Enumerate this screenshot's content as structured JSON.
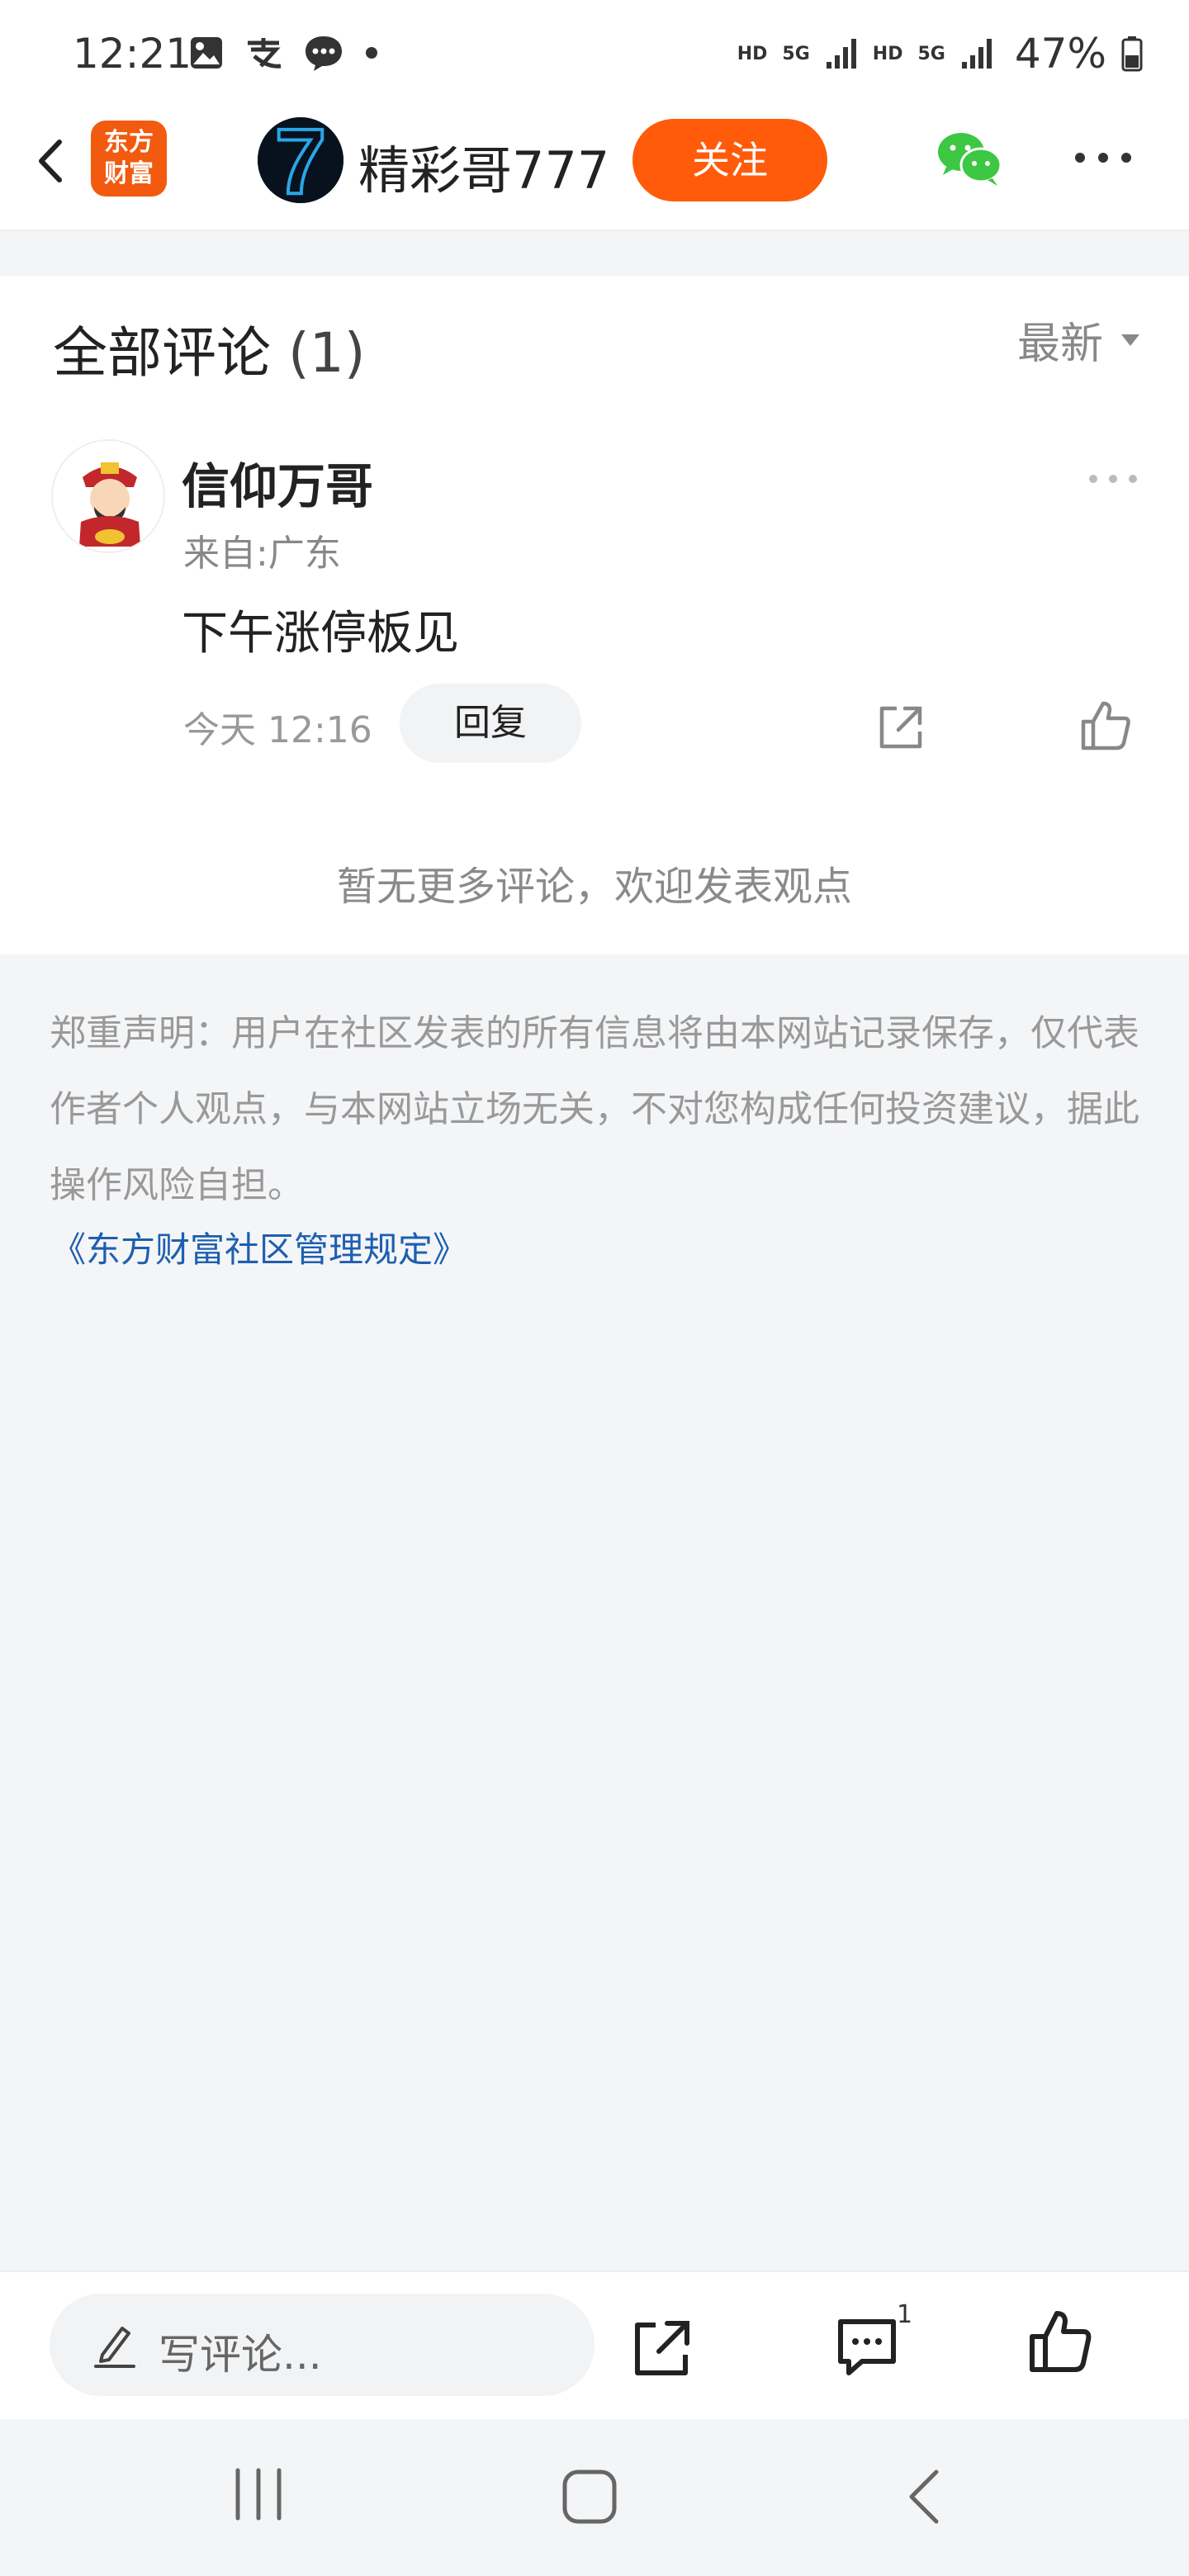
{
  "status_bar": {
    "time": "12:21",
    "network_1": "HD",
    "network_1_gen": "5G",
    "network_2": "HD",
    "network_2_gen": "5G",
    "battery": "47%"
  },
  "header": {
    "app_logo_line1": "东方",
    "app_logo_line2": "财富",
    "user_name": "精彩哥777",
    "follow_label": "关注",
    "avatar_glyph": "7"
  },
  "comments": {
    "title": "全部评论",
    "count": "(1)",
    "sort_label": "最新",
    "items": [
      {
        "name": "信仰万哥",
        "location": "来自:广东",
        "content": "下午涨停板见",
        "time": "今天 12:16",
        "reply_label": "回复"
      }
    ],
    "no_more_text": "暂无更多评论，欢迎发表观点"
  },
  "disclaimer": {
    "text": "郑重声明：用户在社区发表的所有信息将由本网站记录保存，仅代表作者个人观点，与本网站立场无关，不对您构成任何投资建议，据此操作风险自担。",
    "rules_link": "《东方财富社区管理规定》"
  },
  "bottom_bar": {
    "input_placeholder": "写评论...",
    "comment_count": "1"
  },
  "colors": {
    "accent": "#ff5b0a",
    "logo": "#f25a0f",
    "link": "#1d5fb0",
    "wechat": "#3dc743"
  }
}
